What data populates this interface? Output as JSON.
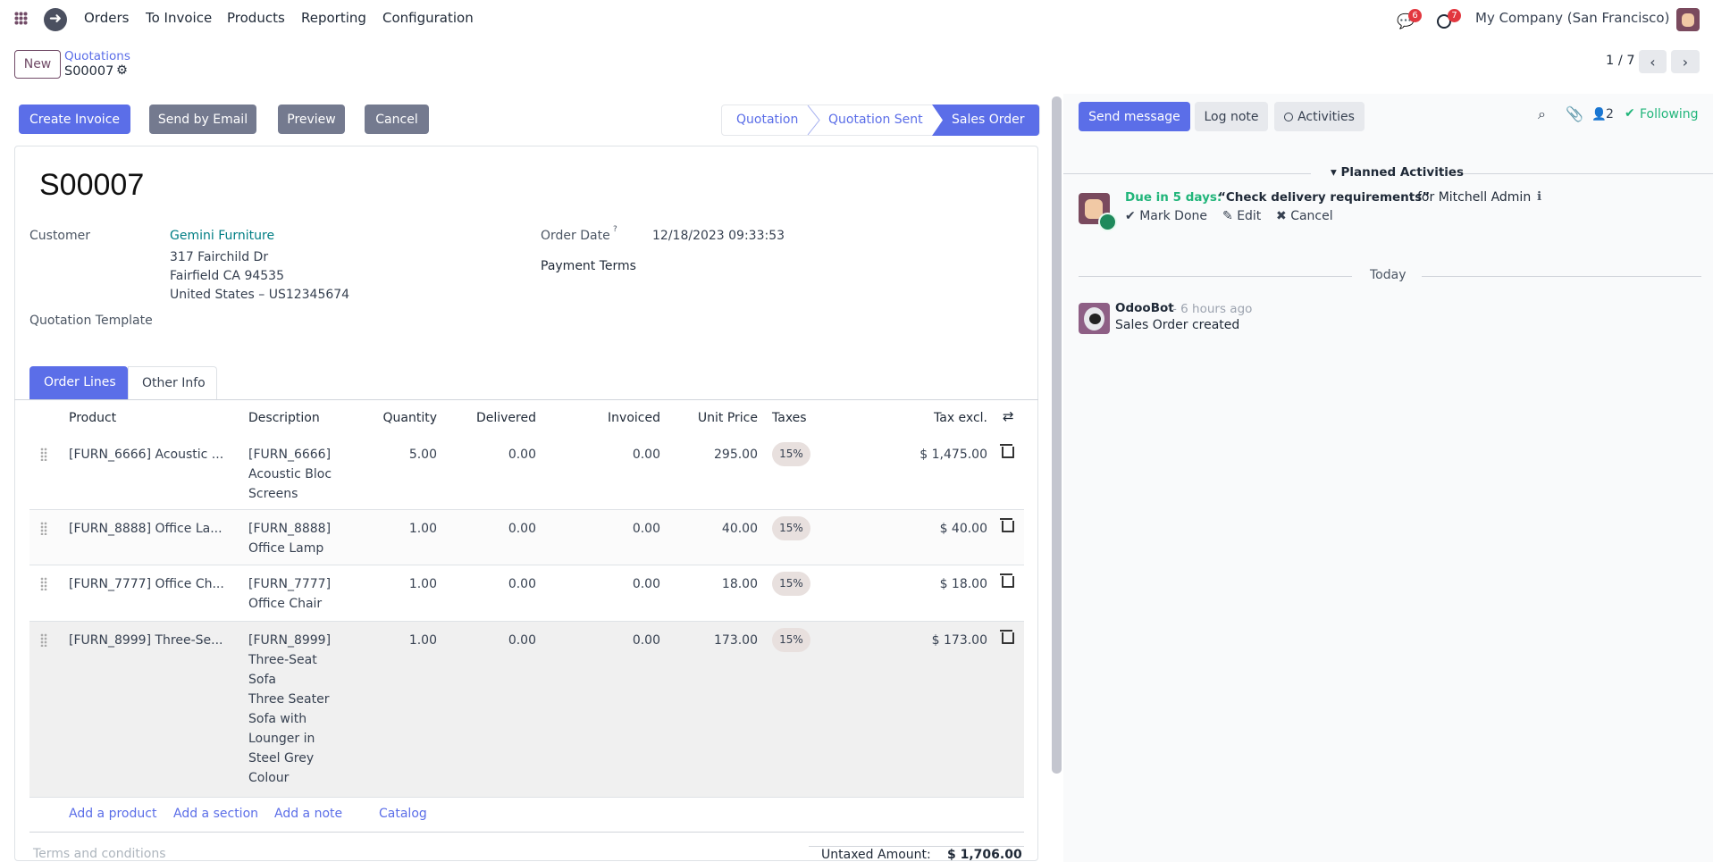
{
  "navbar": {
    "menu": [
      "Orders",
      "To Invoice",
      "Products",
      "Reporting",
      "Configuration"
    ],
    "messages_badge": "6",
    "activities_badge": "7",
    "company": "My Company (San Francisco)"
  },
  "control": {
    "new_label": "New",
    "breadcrumb_parent": "Quotations",
    "breadcrumb_current": "S00007",
    "pager": "1 / 7"
  },
  "actions": [
    "Create Invoice",
    "Send by Email",
    "Preview",
    "Cancel"
  ],
  "statusbar": {
    "steps": [
      "Quotation",
      "Quotation Sent",
      "Sales Order"
    ],
    "active": "Sales Order"
  },
  "form": {
    "title": "S00007",
    "customer_label": "Customer",
    "customer_name": "Gemini Furniture",
    "address": [
      "317 Fairchild Dr",
      "Fairfield CA 94535",
      "United States – US12345674"
    ],
    "template_label": "Quotation Template",
    "order_date_label": "Order Date",
    "order_date_help": "?",
    "order_date": "12/18/2023 09:33:53",
    "payment_terms_label": "Payment Terms"
  },
  "tabs": [
    "Order Lines",
    "Other Info"
  ],
  "table": {
    "headers": [
      "Product",
      "Description",
      "Quantity",
      "Delivered",
      "Invoiced",
      "Unit Price",
      "Taxes",
      "Tax excl."
    ],
    "rows": [
      {
        "product": "[FURN_6666] Acoustic ...",
        "description": [
          "[FURN_6666]",
          "Acoustic Bloc",
          "Screens"
        ],
        "qty": "5.00",
        "delivered": "0.00",
        "invoiced": "0.00",
        "price": "295.00",
        "tax": "15%",
        "subtotal": "$ 1,475.00"
      },
      {
        "product": "[FURN_8888] Office La...",
        "description": [
          "[FURN_8888]",
          "Office Lamp"
        ],
        "qty": "1.00",
        "delivered": "0.00",
        "invoiced": "0.00",
        "price": "40.00",
        "tax": "15%",
        "subtotal": "$ 40.00"
      },
      {
        "product": "[FURN_7777] Office Ch...",
        "description": [
          "[FURN_7777]",
          "Office Chair"
        ],
        "qty": "1.00",
        "delivered": "0.00",
        "invoiced": "0.00",
        "price": "18.00",
        "tax": "15%",
        "subtotal": "$ 18.00"
      },
      {
        "product": "[FURN_8999] Three-Se...",
        "description": [
          "[FURN_8999]",
          "Three-Seat",
          "Sofa",
          "Three Seater",
          "Sofa with",
          "Lounger in",
          "Steel Grey",
          "Colour"
        ],
        "qty": "1.00",
        "delivered": "0.00",
        "invoiced": "0.00",
        "price": "173.00",
        "tax": "15%",
        "subtotal": "$ 173.00"
      }
    ],
    "add_links": [
      "Add a product",
      "Add a section",
      "Add a note",
      "Catalog"
    ]
  },
  "footer": {
    "terms_placeholder": "Terms and conditions",
    "untaxed_label": "Untaxed Amount:",
    "untaxed_value": "$ 1,706.00"
  },
  "chatter": {
    "send_message": "Send message",
    "log_note": "Log note",
    "activities": "Activities",
    "followers_count": "2",
    "following": "Following",
    "planned_title": "Planned Activities",
    "activity": {
      "due": "Due in 5 days:",
      "summary": "“Check delivery requirements”",
      "for": "for Mitchell Admin",
      "mark_done": "Mark Done",
      "edit": "Edit",
      "cancel": "Cancel"
    },
    "today": "Today",
    "message": {
      "author": "OdooBot",
      "time": "- 6 hours ago",
      "body": "Sales Order created"
    }
  },
  "colors": {
    "primary": "#5b6ee8",
    "secondary": "#747a8f",
    "link_teal": "#017e84",
    "success": "#21b57a",
    "badge": "#e2373f"
  }
}
